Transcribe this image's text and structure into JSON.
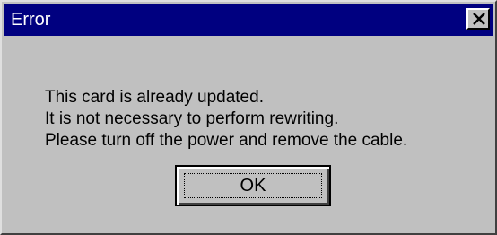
{
  "window": {
    "title": "Error",
    "close_icon": "close-x-icon"
  },
  "message": {
    "lines": [
      "This card is already updated.",
      "It is not necessary to perform rewriting.",
      "Please turn off the power and remove the cable."
    ]
  },
  "buttons": {
    "ok_label": "OK"
  },
  "colors": {
    "titlebar": "#000080",
    "dialog_face": "#c0c0c0"
  }
}
